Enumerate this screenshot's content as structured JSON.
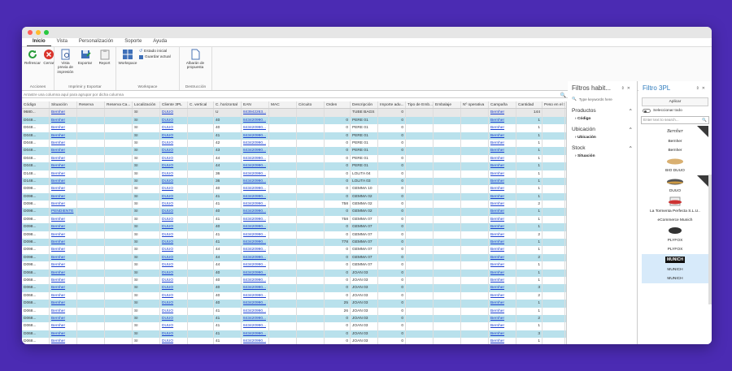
{
  "window": {
    "title": ""
  },
  "menu": [
    "Inicio",
    "Vista",
    "Personalización",
    "Soporte",
    "Ayuda"
  ],
  "ribbon": {
    "acciones": {
      "label": "Acciones",
      "buttons": [
        "Refrescar",
        "Cerrar"
      ]
    },
    "imprimir": {
      "label": "Imprimir y Exportar",
      "buttons": [
        "Vista previa de impresión",
        "Exportar",
        "Report"
      ]
    },
    "workspace": {
      "label": "Workspace",
      "button": "Workspace",
      "small": [
        "Estado inicial",
        "Guardar actual"
      ]
    },
    "destruccion": {
      "label": "Destrucción",
      "button": "Albarán de propuesta"
    }
  },
  "group_hint": "Arrastre una columna aquí para agrupar por dicha columna",
  "columns": [
    "Código",
    "Situación",
    "Reserva",
    "Reserva Ca...",
    "Localización",
    "Cliente 3PL",
    "C. vertical",
    "C. horizontal",
    "EAN",
    "MAC",
    "Circuito",
    "Orden",
    "Descripción",
    "Importe adu...",
    "Tipo de Emb...",
    "Embalaje",
    "Nº operativa",
    "Campaña",
    "Cantidad",
    "Peso en el S..."
  ],
  "rows": [
    [
      "9680...",
      "Bernher",
      "",
      "",
      "SI",
      "DUUO",
      "",
      "U",
      "843942263...",
      "",
      "",
      "",
      "TUBE BAGS",
      "0",
      "",
      "",
      "",
      "Bernher",
      "144",
      ""
    ],
    [
      "D048...",
      "Bernher",
      "",
      "",
      "SI",
      "DUUO",
      "",
      "40",
      "843420990...",
      "",
      "",
      "0",
      "PERE 01",
      "0",
      "",
      "",
      "",
      "Bernher",
      "1",
      ""
    ],
    [
      "D048...",
      "Bernher",
      "",
      "",
      "SI",
      "DUUO",
      "",
      "40",
      "843420990...",
      "",
      "",
      "0",
      "PERE 01",
      "0",
      "",
      "",
      "",
      "Bernher",
      "1",
      ""
    ],
    [
      "D048...",
      "Bernher",
      "",
      "",
      "SI",
      "DUUO",
      "",
      "41",
      "843420990...",
      "",
      "",
      "0",
      "PERE 01",
      "0",
      "",
      "",
      "",
      "Bernher",
      "1",
      ""
    ],
    [
      "D048...",
      "Bernher",
      "",
      "",
      "SI",
      "DUUO",
      "",
      "42",
      "843420990...",
      "",
      "",
      "0",
      "PERE 01",
      "0",
      "",
      "",
      "",
      "Bernher",
      "1",
      ""
    ],
    [
      "D048...",
      "Bernher",
      "",
      "",
      "SI",
      "DUUO",
      "",
      "43",
      "843420990...",
      "",
      "",
      "0",
      "PERE 01",
      "0",
      "",
      "",
      "",
      "Bernher",
      "1",
      ""
    ],
    [
      "D048...",
      "Bernher",
      "",
      "",
      "SI",
      "DUUO",
      "",
      "44",
      "843420990...",
      "",
      "",
      "0",
      "PERE 01",
      "0",
      "",
      "",
      "",
      "Bernher",
      "1",
      ""
    ],
    [
      "D048...",
      "Bernher",
      "",
      "",
      "SI",
      "DUUO",
      "",
      "44",
      "843420990...",
      "",
      "",
      "0",
      "PERE 01",
      "0",
      "",
      "",
      "",
      "Bernher",
      "1",
      ""
    ],
    [
      "D148...",
      "Bernher",
      "",
      "",
      "SI",
      "DUUO",
      "",
      "36",
      "843420990...",
      "",
      "",
      "0",
      "LOLITA 04",
      "0",
      "",
      "",
      "",
      "Bernher",
      "1",
      ""
    ],
    [
      "D148...",
      "Bernher",
      "",
      "",
      "SI",
      "DUUO",
      "",
      "36",
      "843420990...",
      "",
      "",
      "0",
      "LOLITA 03",
      "0",
      "",
      "",
      "",
      "Bernher",
      "1",
      ""
    ],
    [
      "D098...",
      "Bernher",
      "",
      "",
      "SI",
      "DUUO",
      "",
      "40",
      "843420990...",
      "",
      "",
      "0",
      "GEMMA 10",
      "0",
      "",
      "",
      "",
      "Bernher",
      "1",
      ""
    ],
    [
      "D098...",
      "Bernher",
      "",
      "",
      "SI",
      "DUUO",
      "",
      "41",
      "843420990...",
      "",
      "",
      "0",
      "GEMMA 02",
      "0",
      "",
      "",
      "",
      "Bernher",
      "1",
      ""
    ],
    [
      "D098...",
      "Bernher",
      "",
      "",
      "SI",
      "DUUO",
      "",
      "41",
      "843420990...",
      "",
      "",
      "758",
      "GEMMA 02",
      "0",
      "",
      "",
      "",
      "Bernher",
      "2",
      ""
    ],
    [
      "D098...",
      "PENDIENTE",
      "",
      "",
      "SI",
      "DUUO",
      "",
      "40",
      "843420990...",
      "",
      "",
      "0",
      "GEMMA 02",
      "0",
      "",
      "",
      "",
      "Bernher",
      "1",
      ""
    ],
    [
      "D098...",
      "Bernher",
      "",
      "",
      "SI",
      "DUUO",
      "",
      "41",
      "843420990...",
      "",
      "",
      "758",
      "GEMMA 07",
      "0",
      "",
      "",
      "",
      "Bernher",
      "1",
      ""
    ],
    [
      "D098...",
      "Bernher",
      "",
      "",
      "SI",
      "DUUO",
      "",
      "40",
      "843420990...",
      "",
      "",
      "0",
      "GEMMA 07",
      "0",
      "",
      "",
      "",
      "Bernher",
      "1",
      ""
    ],
    [
      "D098...",
      "Bernher",
      "",
      "",
      "SI",
      "DUUO",
      "",
      "41",
      "843420990...",
      "",
      "",
      "0",
      "GEMMA 07",
      "0",
      "",
      "",
      "",
      "Bernher",
      "2",
      ""
    ],
    [
      "D098...",
      "Bernher",
      "",
      "",
      "SI",
      "DUUO",
      "",
      "41",
      "843420990...",
      "",
      "",
      "778",
      "GEMMA 07",
      "0",
      "",
      "",
      "",
      "Bernher",
      "1",
      ""
    ],
    [
      "D098...",
      "Bernher",
      "",
      "",
      "SI",
      "DUUO",
      "",
      "44",
      "843420990...",
      "",
      "",
      "0",
      "GEMMA 07",
      "0",
      "",
      "",
      "",
      "Bernher",
      "1",
      ""
    ],
    [
      "D098...",
      "Bernher",
      "",
      "",
      "SI",
      "DUUO",
      "",
      "44",
      "843420990...",
      "",
      "",
      "0",
      "GEMMA 07",
      "0",
      "",
      "",
      "",
      "Bernher",
      "2",
      ""
    ],
    [
      "D098...",
      "Bernher",
      "",
      "",
      "SI",
      "DUUO",
      "",
      "44",
      "843420990...",
      "",
      "",
      "0",
      "GEMMA 07",
      "0",
      "",
      "",
      "",
      "Bernher",
      "1",
      ""
    ],
    [
      "D068...",
      "Bernher",
      "",
      "",
      "SI",
      "DUUO",
      "",
      "40",
      "843420990...",
      "",
      "",
      "0",
      "JOAN 03",
      "0",
      "",
      "",
      "",
      "Bernher",
      "1",
      ""
    ],
    [
      "D068...",
      "Bernher",
      "",
      "",
      "SI",
      "DUUO",
      "",
      "40",
      "843420990...",
      "",
      "",
      "0",
      "JOAN 03",
      "0",
      "",
      "",
      "",
      "Bernher",
      "1",
      ""
    ],
    [
      "D068...",
      "Bernher",
      "",
      "",
      "SI",
      "DUUO",
      "",
      "40",
      "843420990...",
      "",
      "",
      "0",
      "JOAN 03",
      "0",
      "",
      "",
      "",
      "Bernher",
      "3",
      ""
    ],
    [
      "D068...",
      "Bernher",
      "",
      "",
      "SI",
      "DUUO",
      "",
      "40",
      "843420990...",
      "",
      "",
      "0",
      "JOAN 03",
      "0",
      "",
      "",
      "",
      "Bernher",
      "2",
      ""
    ],
    [
      "D068...",
      "Bernher",
      "",
      "",
      "SI",
      "DUUO",
      "",
      "40",
      "843420990...",
      "",
      "",
      "25",
      "JOAN 03",
      "0",
      "",
      "",
      "",
      "Bernher",
      "1",
      ""
    ],
    [
      "D068...",
      "Bernher",
      "",
      "",
      "SI",
      "DUUO",
      "",
      "41",
      "843420990...",
      "",
      "",
      "26",
      "JOAN 03",
      "0",
      "",
      "",
      "",
      "Bernher",
      "1",
      ""
    ],
    [
      "D068...",
      "Bernher",
      "",
      "",
      "SI",
      "DUUO",
      "",
      "41",
      "843420990...",
      "",
      "",
      "0",
      "JOAN 03",
      "0",
      "",
      "",
      "",
      "Bernher",
      "2",
      ""
    ],
    [
      "D068...",
      "Bernher",
      "",
      "",
      "SI",
      "DUUO",
      "",
      "41",
      "843420990...",
      "",
      "",
      "0",
      "JOAN 03",
      "0",
      "",
      "",
      "",
      "Bernher",
      "1",
      ""
    ],
    [
      "D068...",
      "Bernher",
      "",
      "",
      "SI",
      "DUUO",
      "",
      "41",
      "843420990...",
      "",
      "",
      "0",
      "JOAN 03",
      "0",
      "",
      "",
      "",
      "Bernher",
      "3",
      ""
    ],
    [
      "D068...",
      "Bernher",
      "",
      "",
      "SI",
      "DUUO",
      "",
      "41",
      "843420990...",
      "",
      "",
      "0",
      "JOAN 03",
      "0",
      "",
      "",
      "",
      "Bernher",
      "1",
      ""
    ]
  ],
  "filtros": {
    "title": "Filtros habit...",
    "search_placeholder": "Type keywords here",
    "sections": [
      {
        "label": "Productos",
        "sub": "Código"
      },
      {
        "label": "Ubicación",
        "sub": "Ubicación"
      },
      {
        "label": "Stock",
        "sub": "Situación"
      }
    ]
  },
  "filtro3pl": {
    "title": "Filtro 3PL",
    "aplicar": "Aplicar",
    "select_all": "Seleccionar todo",
    "search_placeholder": "Enter text to search...",
    "brands": [
      "Bernher",
      "BIO DUUO",
      "DUUO",
      "La Tormenta Perfecta S.L.U..",
      "eCommerce Munich",
      "PLYFOX",
      "MUNICH"
    ],
    "logo_text": "MUNICH"
  }
}
